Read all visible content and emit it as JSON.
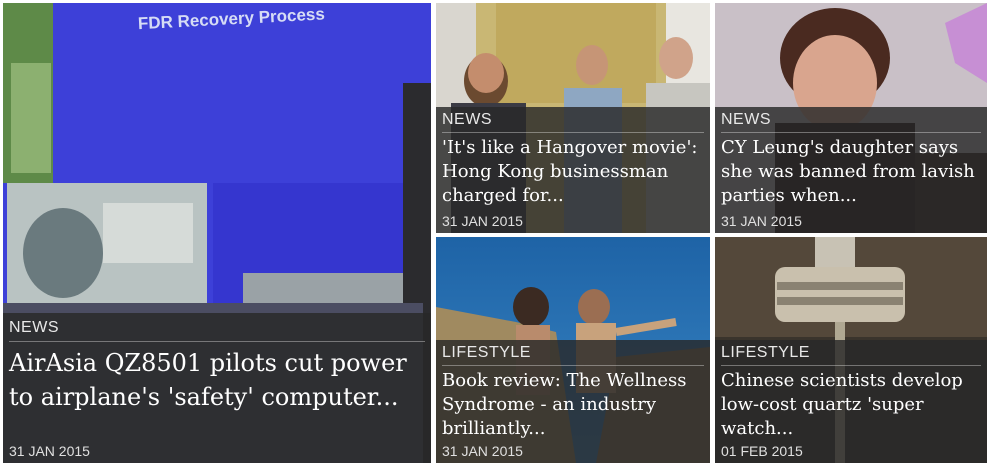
{
  "articles": [
    {
      "category": "NEWS",
      "headline": "AirAsia QZ8501 pilots cut power to airplane's 'safety' computer...",
      "date": "31 JAN 2015",
      "slide_title": "FDR Recovery Process"
    },
    {
      "category": "NEWS",
      "headline": "'It's like a Hangover movie': Hong Kong businessman charged for...",
      "date": "31 JAN 2015"
    },
    {
      "category": "NEWS",
      "headline": "CY Leung's daughter says she was banned from lavish parties when...",
      "date": "31 JAN 2015"
    },
    {
      "category": "LIFESTYLE",
      "headline": "Book review: The Wellness Syndrome - an industry brilliantly...",
      "date": "31 JAN 2015"
    },
    {
      "category": "LIFESTYLE",
      "headline": "Chinese scientists develop low-cost quartz 'super watch...",
      "date": "01 FEB 2015"
    }
  ]
}
